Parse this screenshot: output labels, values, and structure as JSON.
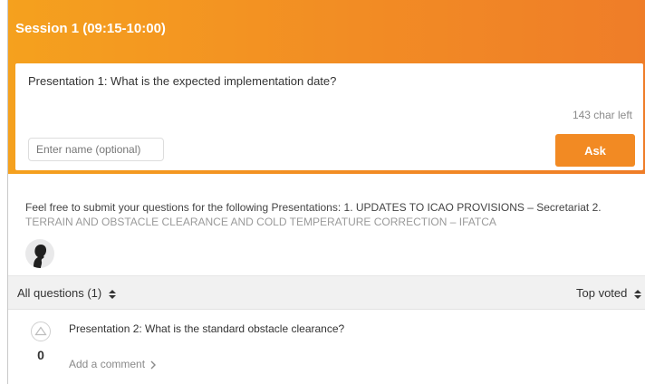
{
  "session": {
    "title": "Session 1 (09:15-10:00)"
  },
  "ask_form": {
    "question_text": "Presentation 1: What is the expected implementation date?",
    "char_left": "143 char left",
    "name_placeholder": "Enter name (optional)",
    "name_value": "",
    "ask_label": "Ask"
  },
  "description": {
    "line1": "Feel free to submit your questions for the following Presentations: 1. UPDATES TO ICAO PROVISIONS – Secretariat 2.",
    "line2": "TERRAIN AND OBSTACLE CLEARANCE AND COLD TEMPERATURE CORRECTION – IFATCA"
  },
  "filters": {
    "all_questions": "All questions (1)",
    "sort": "Top voted"
  },
  "questions": [
    {
      "text": "Presentation 2: What is the standard obstacle clearance?",
      "votes": "0",
      "add_comment": "Add a comment"
    }
  ],
  "colors": {
    "accent": "#f28a23",
    "header_start": "#f5a11e",
    "header_end": "#ef7d28"
  },
  "icons": {
    "avatar": "user-silhouette-icon",
    "sort": "sort-updown-icon",
    "vote": "vote-up-triangle-icon",
    "comment": "chevron-right-icon"
  }
}
